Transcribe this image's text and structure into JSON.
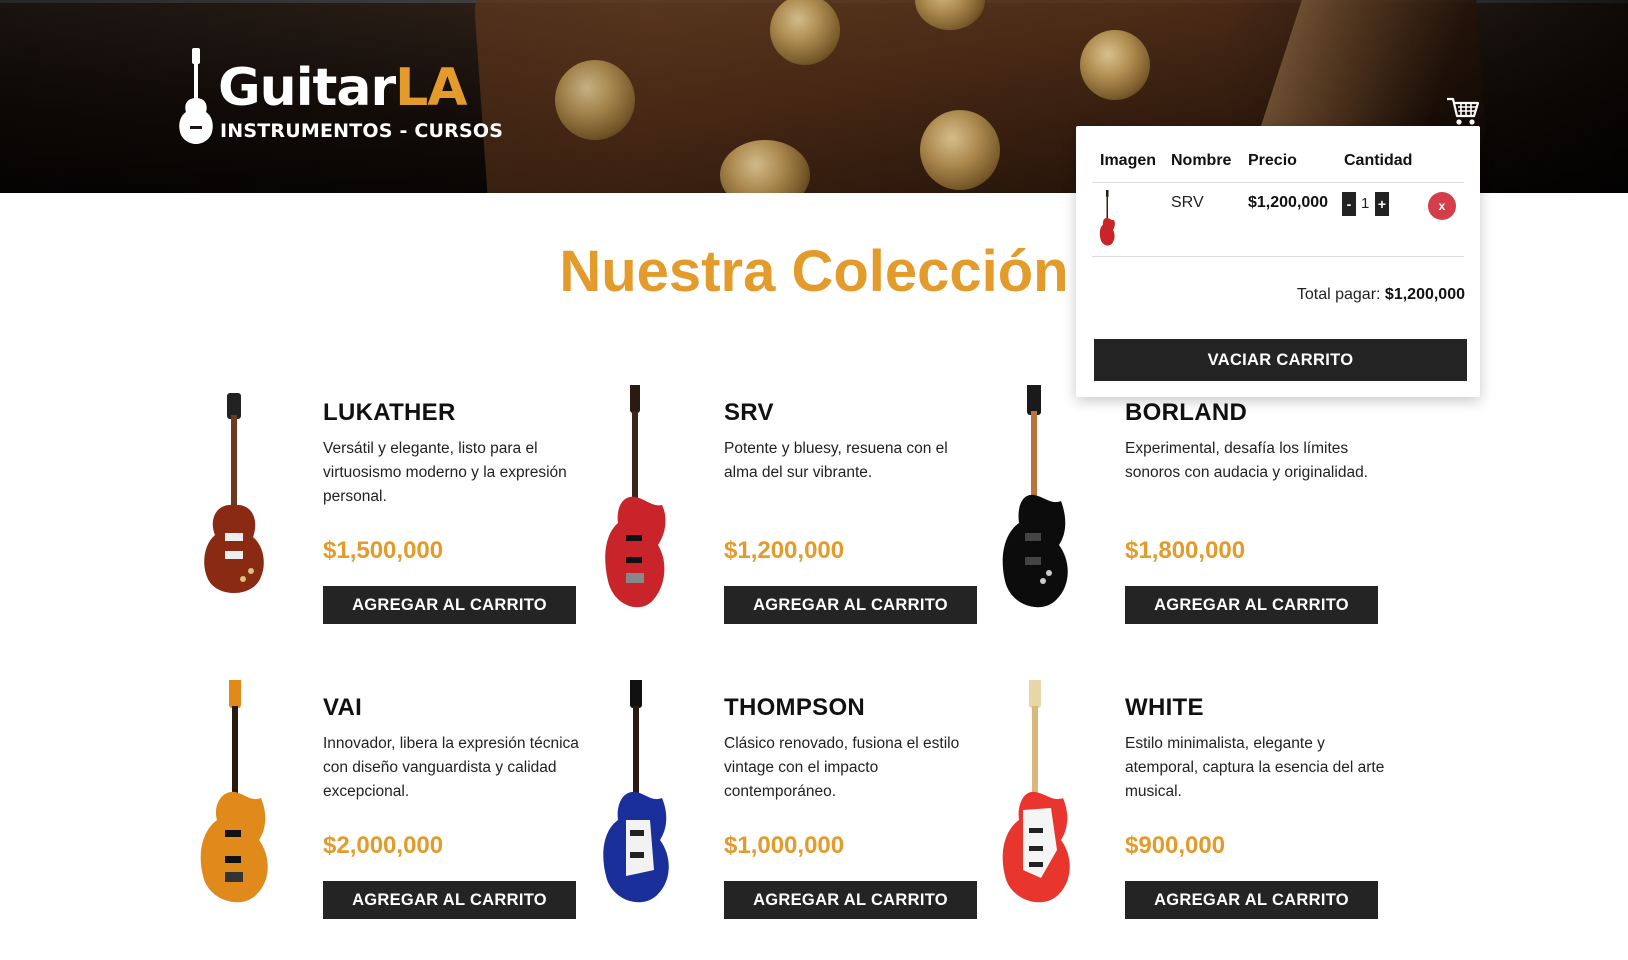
{
  "header": {
    "brand_main": "Guitar",
    "brand_accent": "LA",
    "tagline": "INSTRUMENTOS - CURSOS"
  },
  "title": "Nuestra Colección",
  "add_label": "AGREGAR AL CARRITO",
  "products": [
    {
      "name": "LUKATHER",
      "description": "Versátil y elegante, listo para el virtuosismo moderno y la expresión personal.",
      "price": "$1,500,000"
    },
    {
      "name": "SRV",
      "description": "Potente y bluesy, resuena con el alma del sur vibrante.",
      "price": "$1,200,000"
    },
    {
      "name": "BORLAND",
      "description": "Experimental, desafía los límites sonoros con audacia y originalidad.",
      "price": "$1,800,000"
    },
    {
      "name": "VAI",
      "description": "Innovador, libera la expresión técnica con diseño vanguardista y calidad excepcional.",
      "price": "$2,000,000"
    },
    {
      "name": "THOMPSON",
      "description": "Clásico renovado, fusiona el estilo vintage con el impacto contemporáneo.",
      "price": "$1,000,000"
    },
    {
      "name": "WHITE",
      "description": "Estilo minimalista, elegante y atemporal, captura la esencia del arte musical.",
      "price": "$900,000"
    }
  ],
  "cart": {
    "headers": {
      "image": "Imagen",
      "name": "Nombre",
      "price": "Precio",
      "quantity": "Cantidad"
    },
    "items": [
      {
        "name": "SRV",
        "price": "$1,200,000",
        "quantity": "1",
        "decrement": "-",
        "increment": "+",
        "remove": "x"
      }
    ],
    "total_label": "Total pagar:",
    "total_value": "$1,200,000",
    "empty_label": "VACIAR CARRITO"
  },
  "guitar_colors": {
    "lukather": "#8a2a12",
    "srv": "#c8242a",
    "borland": "#0c0c0c",
    "vai": "#e08a1c",
    "thompson": "#1a2f9a",
    "white": "#e8362f"
  }
}
